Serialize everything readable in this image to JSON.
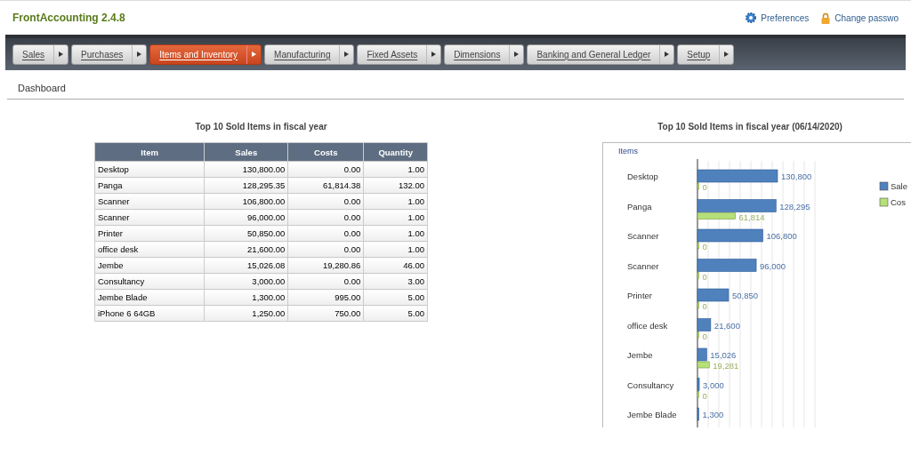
{
  "header": {
    "app_title": "FrontAccounting 2.4.8",
    "links": [
      {
        "kind": "preferences",
        "label": "Preferences"
      },
      {
        "kind": "password",
        "label": "Change passwo"
      }
    ]
  },
  "nav": [
    {
      "label": "Sales",
      "selected": false
    },
    {
      "label": "Purchases",
      "selected": false
    },
    {
      "label": "Items and Inventory",
      "selected": true
    },
    {
      "label": "Manufacturing",
      "selected": false
    },
    {
      "label": "Fixed Assets",
      "selected": false
    },
    {
      "label": "Dimensions",
      "selected": false
    },
    {
      "label": "Banking and General Ledger",
      "selected": false
    },
    {
      "label": "Setup",
      "selected": false
    }
  ],
  "page_title": "Dashboard",
  "table": {
    "title": "Top 10 Sold Items in fiscal year",
    "columns": [
      "Item",
      "Sales",
      "Costs",
      "Quantity"
    ],
    "rows": [
      [
        "Desktop",
        "130,800.00",
        "0.00",
        "1.00"
      ],
      [
        "Panga",
        "128,295.35",
        "61,814.38",
        "132.00"
      ],
      [
        "Scanner",
        "106,800.00",
        "0.00",
        "1.00"
      ],
      [
        "Scanner",
        "96,000.00",
        "0.00",
        "1.00"
      ],
      [
        "Printer",
        "50,850.00",
        "0.00",
        "1.00"
      ],
      [
        "office desk",
        "21,600.00",
        "0.00",
        "1.00"
      ],
      [
        "Jembe",
        "15,026.08",
        "19,280.86",
        "46.00"
      ],
      [
        "Consultancy",
        "3,000.00",
        "0.00",
        "3.00"
      ],
      [
        "Jembe Blade",
        "1,300.00",
        "995.00",
        "5.00"
      ],
      [
        "iPhone 6 64GB",
        "1,250.00",
        "750.00",
        "5.00"
      ]
    ]
  },
  "chart": {
    "chart_data": {
      "type": "bar",
      "orientation": "horizontal",
      "title": "Top 10 Sold Items in fiscal year (06/14/2020)",
      "ylabel": "Items",
      "legend": true,
      "data_labels": true,
      "categories": [
        "Desktop",
        "Panga",
        "Scanner",
        "Scanner",
        "Printer",
        "office desk",
        "Jembe",
        "Consultancy",
        "Jembe Blade"
      ],
      "series": [
        {
          "name": "Sale",
          "color": "#4f81bd",
          "values": [
            130800,
            128295,
            106800,
            96000,
            50850,
            21600,
            15026,
            3000,
            1300
          ],
          "value_labels": [
            "130,800",
            "128,295",
            "106,800",
            "96,000",
            "50,850",
            "21,600",
            "15,026",
            "3,000",
            "1,300"
          ]
        },
        {
          "name": "Cos",
          "color": "#b5e07a",
          "values": [
            0,
            61814,
            0,
            0,
            0,
            0,
            19281,
            0,
            null
          ],
          "value_labels": [
            "0",
            "61,814",
            "0",
            "0",
            "0",
            "0",
            "19,281",
            "0",
            null
          ]
        }
      ]
    }
  }
}
